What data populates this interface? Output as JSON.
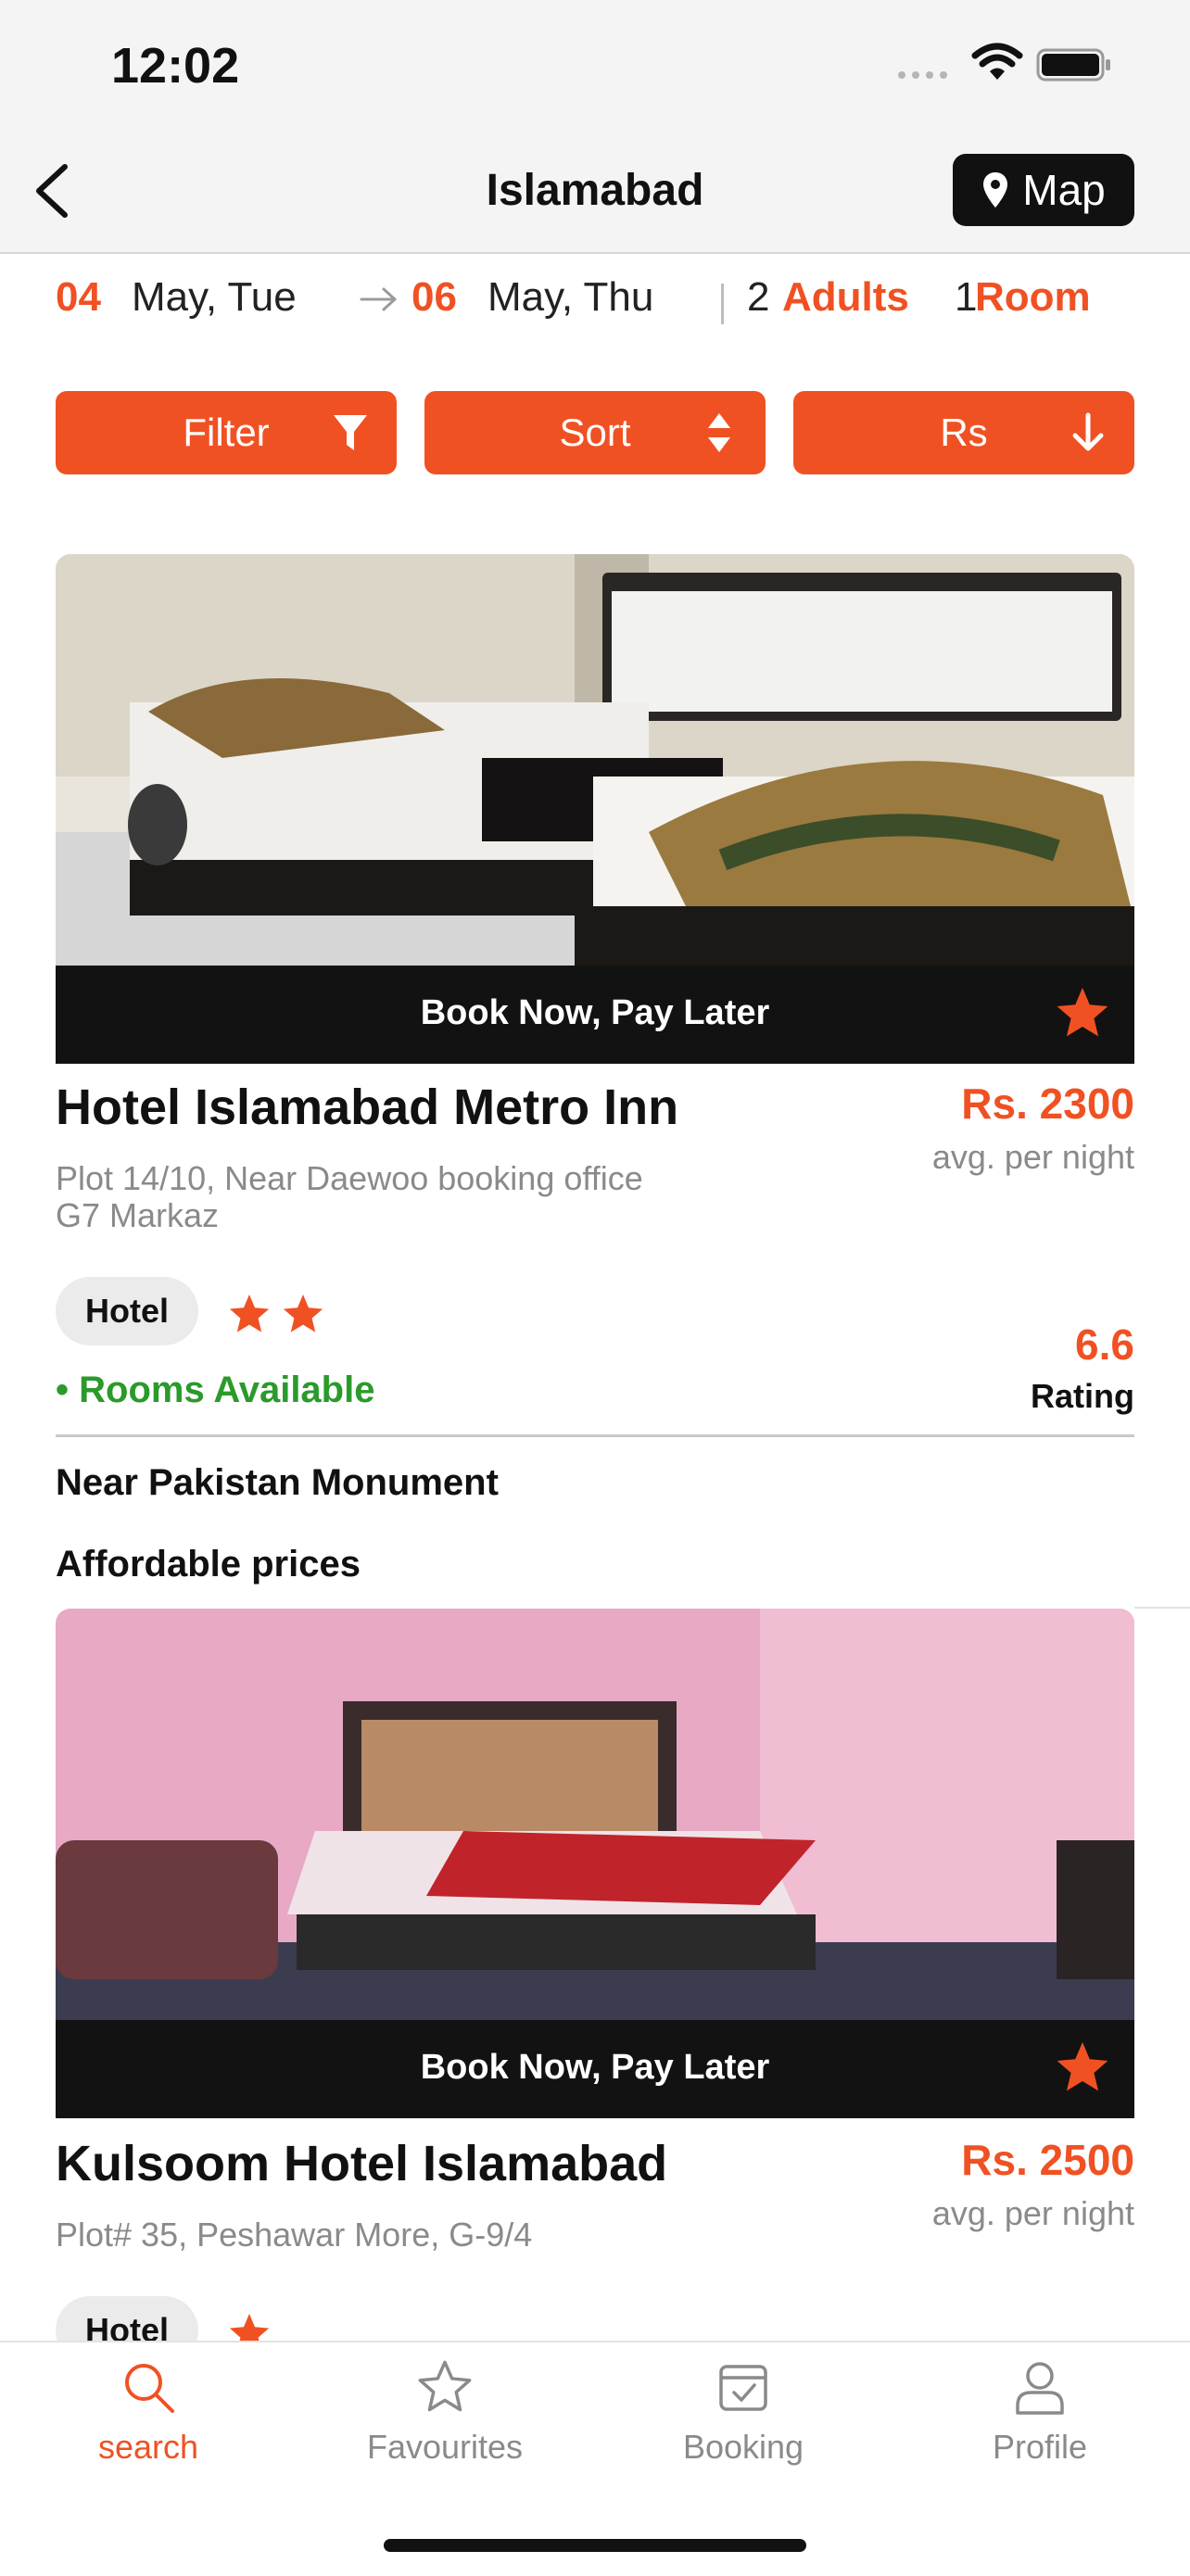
{
  "status_bar": {
    "time": "12:02"
  },
  "nav": {
    "title": "Islamabad",
    "map_label": "Map"
  },
  "search": {
    "checkin_day": "04",
    "checkin_rest": "May, Tue",
    "checkout_day": "06",
    "checkout_rest": "May, Thu",
    "adults_count": "2",
    "adults_label": "Adults",
    "rooms_count": "1",
    "rooms_label": "Room"
  },
  "controls": {
    "filter": "Filter",
    "sort": "Sort",
    "currency": "Rs"
  },
  "colors": {
    "accent": "#f05123",
    "available": "#2a9a2a",
    "banner": "#121212"
  },
  "hotels": [
    {
      "banner": "Book Now, Pay Later",
      "name": "Hotel Islamabad Metro Inn",
      "price": "Rs. 2300",
      "price_note": "avg. per night",
      "address_line1": "Plot 14/10, Near Daewoo booking office",
      "address_line2": "G7 Markaz",
      "type": "Hotel",
      "stars": 2,
      "availability": "• Rooms Available",
      "rating": "6.6",
      "rating_label": "Rating",
      "features": [
        "Near Pakistan Monument",
        "Affordable prices"
      ]
    },
    {
      "banner": "Book Now, Pay Later",
      "name": "Kulsoom Hotel Islamabad",
      "price": "Rs. 2500",
      "price_note": "avg. per night",
      "address_line1": "Plot# 35, Peshawar More, G-9/4",
      "type": "Hotel",
      "stars": 1
    }
  ],
  "tabs": [
    {
      "label": "search",
      "icon": "search-icon",
      "active": true
    },
    {
      "label": "Favourites",
      "icon": "star-outline-icon",
      "active": false
    },
    {
      "label": "Booking",
      "icon": "calendar-check-icon",
      "active": false
    },
    {
      "label": "Profile",
      "icon": "person-icon",
      "active": false
    }
  ]
}
